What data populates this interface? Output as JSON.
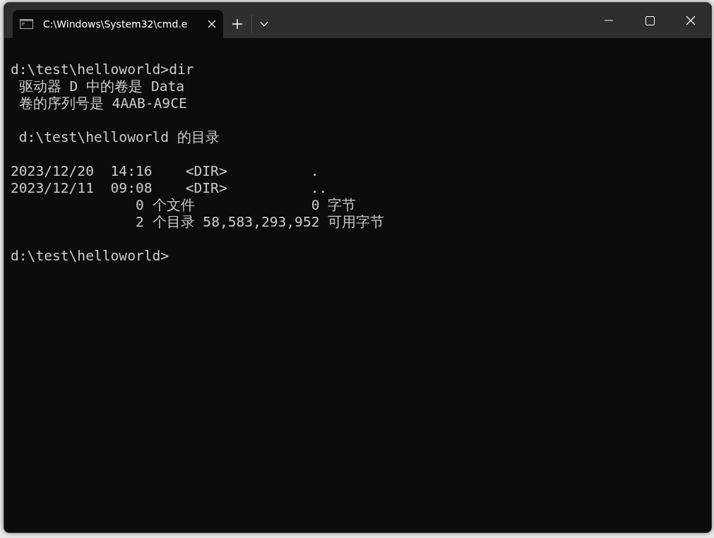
{
  "tabs": [
    {
      "title": "C:\\Windows\\System32\\cmd.e",
      "selected": true
    }
  ],
  "terminal": {
    "blocks": [
      [
        "d:\\test\\helloworld>dir",
        " 驱动器 D 中的卷是 Data",
        " 卷的序列号是 4AAB-A9CE"
      ],
      [
        " d:\\test\\helloworld 的目录"
      ],
      [
        "2023/12/20  14:16    <DIR>          .",
        "2023/12/11  09:08    <DIR>          ..",
        "               0 个文件              0 字节",
        "               2 个目录 58,583,293,952 可用字节"
      ],
      [
        "d:\\test\\helloworld>"
      ]
    ]
  }
}
